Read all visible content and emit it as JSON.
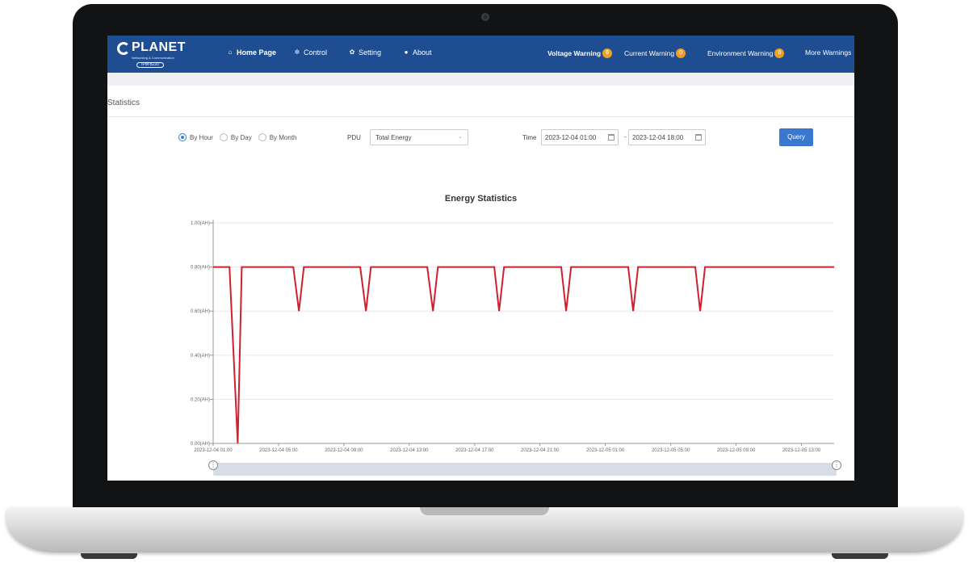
{
  "nav": {
    "logo": {
      "brand": "PLANET",
      "tagline": "Networking & Communication",
      "model": "IPM-8220"
    },
    "items": [
      {
        "label": "Home Page",
        "icon": "home-icon",
        "active": true
      },
      {
        "label": "Control",
        "icon": "control-icon",
        "active": false
      },
      {
        "label": "Setting",
        "icon": "gear-icon",
        "active": false
      },
      {
        "label": "About",
        "icon": "info-icon",
        "active": false
      }
    ],
    "warnings": [
      {
        "label": "Voltage Warning",
        "count": "0"
      },
      {
        "label": "Current Warning",
        "count": "0"
      },
      {
        "label": "Environment Warning",
        "count": "0"
      },
      {
        "label": "More Warnings"
      }
    ]
  },
  "page": {
    "section_title": "Statistics"
  },
  "filters": {
    "modes": [
      {
        "label": "By Hour",
        "selected": true
      },
      {
        "label": "By Day",
        "selected": false
      },
      {
        "label": "By Month",
        "selected": false
      }
    ],
    "pdu_label": "PDU",
    "pdu_value": "Total Energy",
    "time_label": "Time",
    "time_start": "2023-12-04 01:00",
    "time_sep": "-",
    "time_end": "2023-12-04 18:00",
    "query_label": "Query"
  },
  "colors": {
    "nav_bg": "#1f4d92",
    "badge": "#f0a020",
    "line": "#d0202e",
    "button": "#3a78d0"
  },
  "chart_data": {
    "type": "line",
    "title": "Energy Statistics",
    "y_tick_labels": [
      "0.00(AH)",
      "0.20(AH)",
      "0.40(AH)",
      "0.60(AH)",
      "0.80(AH)",
      "1.00(AH)"
    ],
    "ylim": [
      0,
      1.0
    ],
    "x_tick_labels": [
      "2023-12-04 01:00",
      "2023-12-04 05:00",
      "2023-12-04 09:00",
      "2023-12-04 13:00",
      "2023-12-04 17:00",
      "2023-12-04 21:00",
      "2023-12-05 01:00",
      "2023-12-05 05:00",
      "2023-12-05 09:00",
      "2023-12-05 13:00"
    ],
    "x_hours_range": [
      0,
      38
    ],
    "series": [
      {
        "name": "Energy",
        "color": "#d0202e",
        "x_hours": [
          0,
          1.0,
          1.5,
          1.75,
          4.9,
          5.25,
          5.55,
          9.0,
          9.35,
          9.65,
          13.1,
          13.45,
          13.75,
          17.2,
          17.5,
          17.8,
          21.3,
          21.6,
          21.9,
          25.4,
          25.7,
          26.0,
          29.5,
          29.8,
          30.1,
          38.0
        ],
        "values": [
          0.8,
          0.8,
          0.0,
          0.8,
          0.8,
          0.6,
          0.8,
          0.8,
          0.6,
          0.8,
          0.8,
          0.6,
          0.8,
          0.8,
          0.6,
          0.8,
          0.8,
          0.6,
          0.8,
          0.8,
          0.6,
          0.8,
          0.8,
          0.6,
          0.8,
          0.8
        ]
      }
    ],
    "grid": true,
    "legend": "none"
  }
}
